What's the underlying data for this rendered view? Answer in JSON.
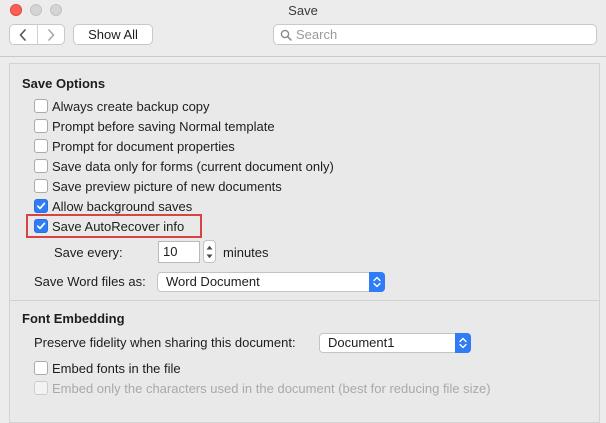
{
  "window": {
    "title": "Save"
  },
  "toolbar": {
    "show_all_label": "Show All",
    "search_placeholder": "Search"
  },
  "save_options": {
    "heading": "Save Options",
    "checkboxes": [
      {
        "label": "Always create backup copy",
        "checked": false
      },
      {
        "label": "Prompt before saving Normal template",
        "checked": false
      },
      {
        "label": "Prompt for document properties",
        "checked": false
      },
      {
        "label": "Save data only for forms (current document only)",
        "checked": false
      },
      {
        "label": "Save preview picture of new documents",
        "checked": false
      },
      {
        "label": "Allow background saves",
        "checked": true
      },
      {
        "label": "Save AutoRecover info",
        "checked": true
      }
    ],
    "save_every_label": "Save every:",
    "save_every_value": "10",
    "minutes_label": "minutes",
    "save_as_label": "Save Word files as:",
    "save_as_value": "Word Document"
  },
  "font_embedding": {
    "heading": "Font Embedding",
    "fidelity_label": "Preserve fidelity when sharing this document:",
    "fidelity_value": "Document1",
    "embed_fonts_label": "Embed fonts in the file",
    "embed_fonts_checked": false,
    "embed_chars_label": "Embed only the characters used in the document (best for reducing file size)",
    "embed_chars_checked": false
  },
  "colors": {
    "accent": "#2f7cf6",
    "highlight": "#d84343",
    "close_button": "#fd5f57"
  },
  "icons": {
    "back": "chevron-left-icon",
    "forward": "chevron-right-icon",
    "search": "search-icon",
    "checkmark": "checkmark-icon",
    "select": "up-down-caret-icon"
  }
}
